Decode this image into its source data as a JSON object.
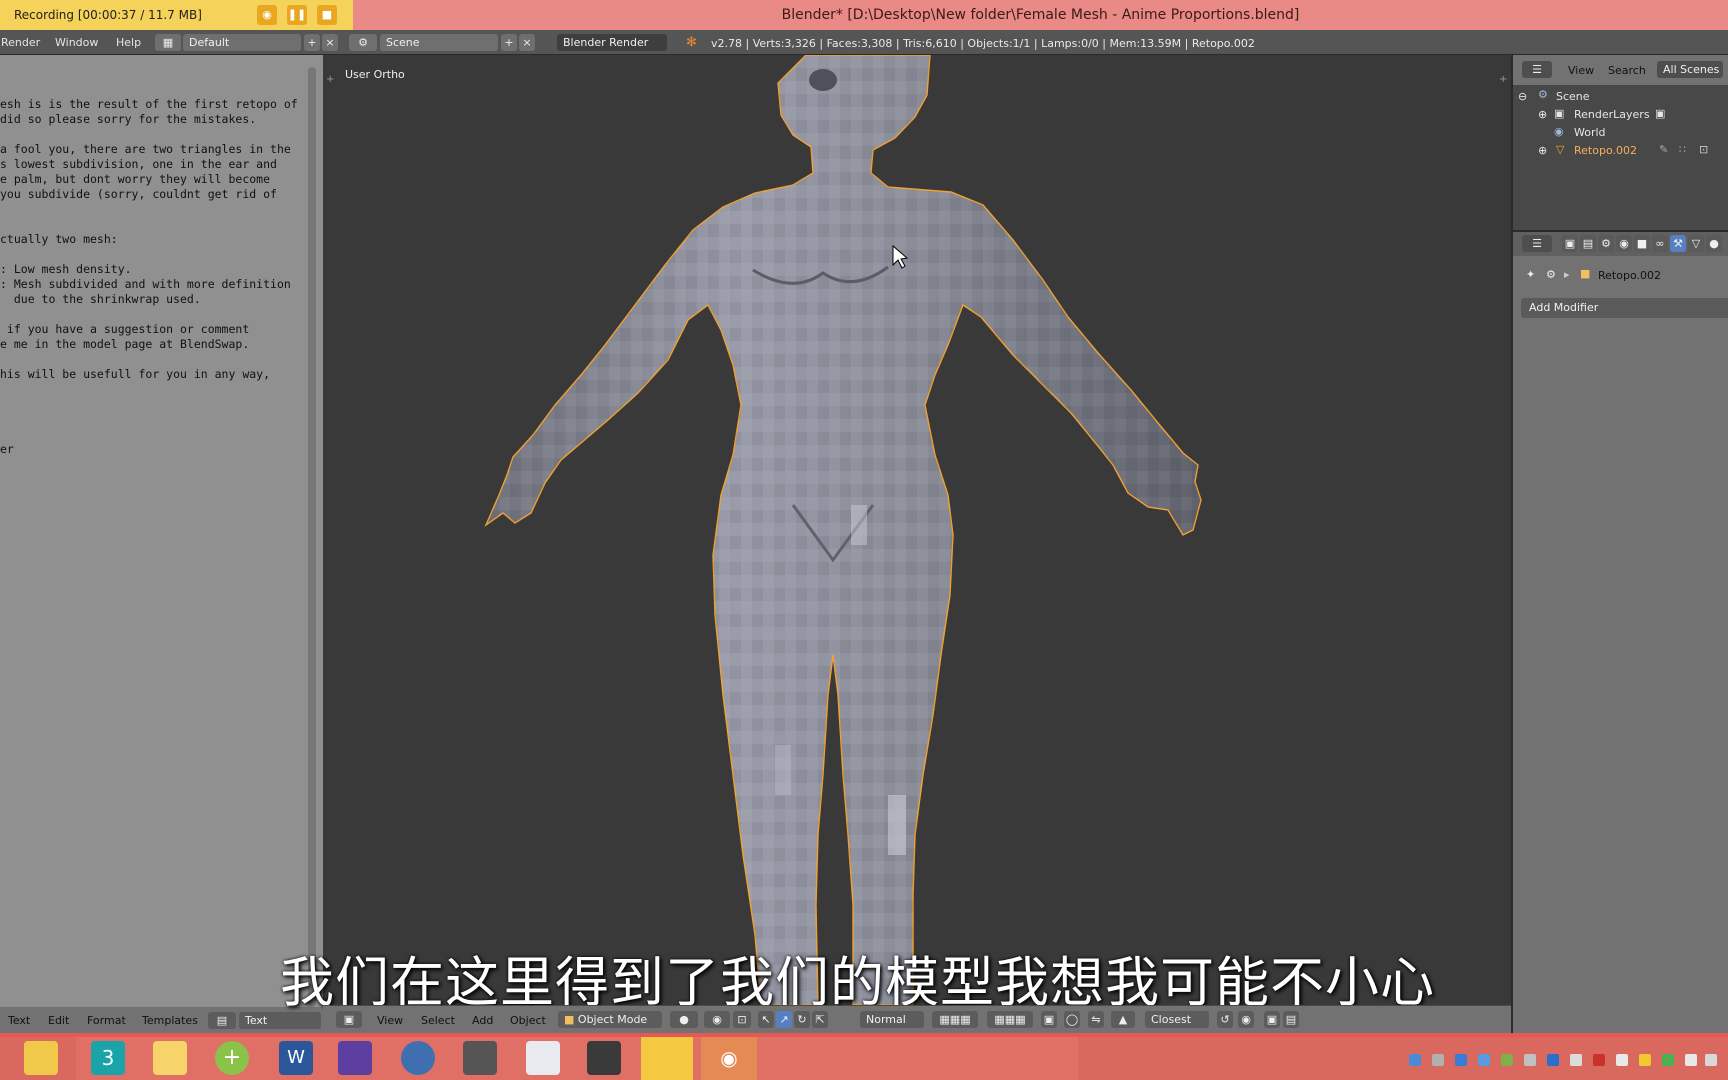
{
  "recording": {
    "label": "Recording  [00:00:37 / 11.7 MB]",
    "buttons": [
      "camera-icon",
      "pause-icon",
      "stop-icon"
    ]
  },
  "window": {
    "title": "Blender* [D:\\Desktop\\New folder\\Female Mesh - Anime Proportions.blend]"
  },
  "info_header": {
    "menus": [
      "Render",
      "Window",
      "Help"
    ],
    "screen_layout": "Default",
    "scene": "Scene",
    "engine": "Blender Render",
    "stats": "v2.78 | Verts:3,326 | Faces:3,308 | Tris:6,610 | Objects:1/1 | Lamps:0/0 | Mem:13.59M | Retopo.002"
  },
  "text_editor": {
    "lines": [
      "esh is is the result of the first retopo of",
      "did so please sorry for the mistakes.",
      "",
      "a fool you, there are two triangles in the",
      "s lowest subdivision, one in the ear and",
      "e palm, but dont worry they will become",
      "you subdivide (sorry, couldnt get rid of",
      "",
      "",
      "ctually two mesh:",
      "",
      ": Low mesh density.",
      ": Mesh subdivided and with more definition",
      "  due to the shrinkwrap used.",
      "",
      " if you have a suggestion or comment",
      "e me in the model page at BlendSwap.",
      "",
      "his will be usefull for you in any way,",
      "",
      "",
      "",
      "",
      "er"
    ],
    "footer_menus": [
      "Text",
      "Edit",
      "Format",
      "Templates"
    ],
    "datablock": "Text"
  },
  "viewport": {
    "label": "User Ortho",
    "footer_menus": [
      "View",
      "Select",
      "Add",
      "Object"
    ],
    "mode": "Object Mode",
    "orientation": "Normal",
    "snap_target": "Closest",
    "subtitle": "我们在这里得到了我们的模型我想我可能不小心"
  },
  "outliner": {
    "tabs": [
      "View",
      "Search",
      "All Scenes"
    ],
    "items": [
      "Scene",
      "RenderLayers",
      "World",
      "Retopo.002"
    ]
  },
  "properties": {
    "object_name": "Retopo.002",
    "add_modifier": "Add Modifier"
  },
  "colors": {
    "title_bar": "#ea8a86",
    "recording_bar": "#f5d25a",
    "viewport_bg": "#393939",
    "mesh": "#8a8c98",
    "selection_outline": "#f0a030",
    "taskbar": "#d9695f"
  },
  "taskbar": {
    "apps": [
      "file-explorer-icon",
      "3ds-max-icon",
      "folder-icon",
      "add-icon",
      "word-icon",
      "calendar-icon",
      "clock-icon",
      "media-icon",
      "musescore-icon",
      "presentation-icon",
      "slideshow-icon",
      "blender-icon"
    ]
  }
}
